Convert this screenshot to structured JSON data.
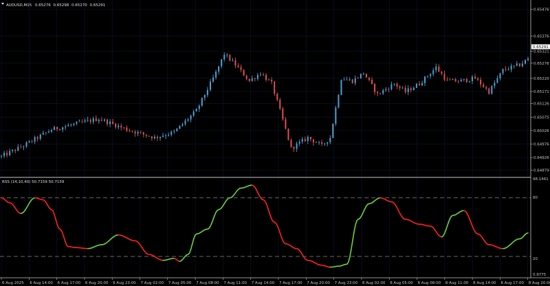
{
  "header": {
    "symbol": "AUDUSD,M15",
    "open": "0.65276",
    "high": "0.65298",
    "low": "0.65270",
    "close": "0.65291"
  },
  "price_panel": {
    "current_price_tag": "0.65291",
    "colors": {
      "up_candle": "#4aa3d8",
      "down_candle": "#e0524f",
      "neutral_candle": "#32c864",
      "grid": "#0c1730",
      "background": "#000000"
    }
  },
  "indicator_panel": {
    "label": "RSS (14,10,40) 50.7159 50.7159",
    "top_value": "98.1461",
    "bottom_value": "0.9775",
    "level_upper": "80",
    "level_lower": "20",
    "colors": {
      "rising": "#6cd23c",
      "falling": "#ff2020",
      "levels": "#8a8a8a"
    }
  },
  "time_labels": [
    "6 Aug 2025",
    "6 Aug 14:00",
    "6 Aug 17:00",
    "6 Aug 20:00",
    "6 Aug 23:00",
    "7 Aug 02:00",
    "7 Aug 05:00",
    "7 Aug 08:00",
    "7 Aug 11:00",
    "7 Aug 14:00",
    "7 Aug 17:00",
    "7 Aug 20:00",
    "7 Aug 23:00",
    "8 Aug 02:00",
    "8 Aug 05:00",
    "8 Aug 08:00",
    "8 Aug 11:00",
    "8 Aug 14:00",
    "8 Aug 17:00",
    "8 Aug 20:00"
  ],
  "chart_data": [
    {
      "type": "candlestick",
      "title": "AUDUSD,M15",
      "y_ticks": [
        "0.65476",
        "0.65376",
        "0.65321",
        "0.65276",
        "0.65220",
        "0.65171",
        "0.65126",
        "0.65075",
        "0.65026",
        "0.64976",
        "0.64926",
        "0.64879"
      ],
      "ylim": [
        0.6486,
        0.6549
      ],
      "grid": true,
      "candle_count": 190,
      "close_anchors": [
        [
          0,
          0.6493
        ],
        [
          8,
          0.6497
        ],
        [
          18,
          0.6503
        ],
        [
          35,
          0.6507
        ],
        [
          45,
          0.6503
        ],
        [
          55,
          0.65
        ],
        [
          62,
          0.6502
        ],
        [
          70,
          0.651
        ],
        [
          77,
          0.6524
        ],
        [
          80,
          0.6531
        ],
        [
          84,
          0.6527
        ],
        [
          89,
          0.6521
        ],
        [
          93,
          0.6524
        ],
        [
          97,
          0.652
        ],
        [
          100,
          0.651
        ],
        [
          104,
          0.6496
        ],
        [
          110,
          0.65
        ],
        [
          115,
          0.6497
        ],
        [
          118,
          0.65
        ],
        [
          122,
          0.6522
        ],
        [
          126,
          0.6521
        ],
        [
          130,
          0.6524
        ],
        [
          135,
          0.6516
        ],
        [
          141,
          0.652
        ],
        [
          145,
          0.6517
        ],
        [
          150,
          0.652
        ],
        [
          156,
          0.6526
        ],
        [
          160,
          0.6521
        ],
        [
          165,
          0.6521
        ],
        [
          170,
          0.6522
        ],
        [
          175,
          0.6517
        ],
        [
          180,
          0.6525
        ],
        [
          186,
          0.6527
        ],
        [
          189,
          0.65291
        ]
      ]
    },
    {
      "type": "line",
      "title": "RSS (14,10,40) 50.7159 50.7159",
      "ylim": [
        0.9775,
        98.1461
      ],
      "levels": [
        80,
        20
      ],
      "x": [
        0,
        3,
        7,
        12,
        15,
        18,
        21,
        24,
        27,
        31,
        36,
        42,
        48,
        53,
        58,
        62,
        64,
        67,
        70,
        74,
        78,
        82,
        86,
        90,
        94,
        98,
        102,
        106,
        110,
        115,
        118,
        121,
        124,
        128,
        132,
        136,
        140,
        145,
        150,
        154,
        158,
        162,
        166,
        171,
        175,
        180,
        186,
        189
      ],
      "values": [
        80,
        75,
        64,
        80,
        78,
        68,
        48,
        30,
        29,
        28,
        32,
        42,
        36,
        22,
        16,
        18,
        15,
        22,
        43,
        48,
        68,
        80,
        90,
        93,
        78,
        55,
        33,
        28,
        16,
        11,
        9,
        10,
        12,
        58,
        74,
        80,
        76,
        58,
        53,
        51,
        40,
        62,
        67,
        43,
        32,
        28,
        38,
        44
      ]
    }
  ]
}
